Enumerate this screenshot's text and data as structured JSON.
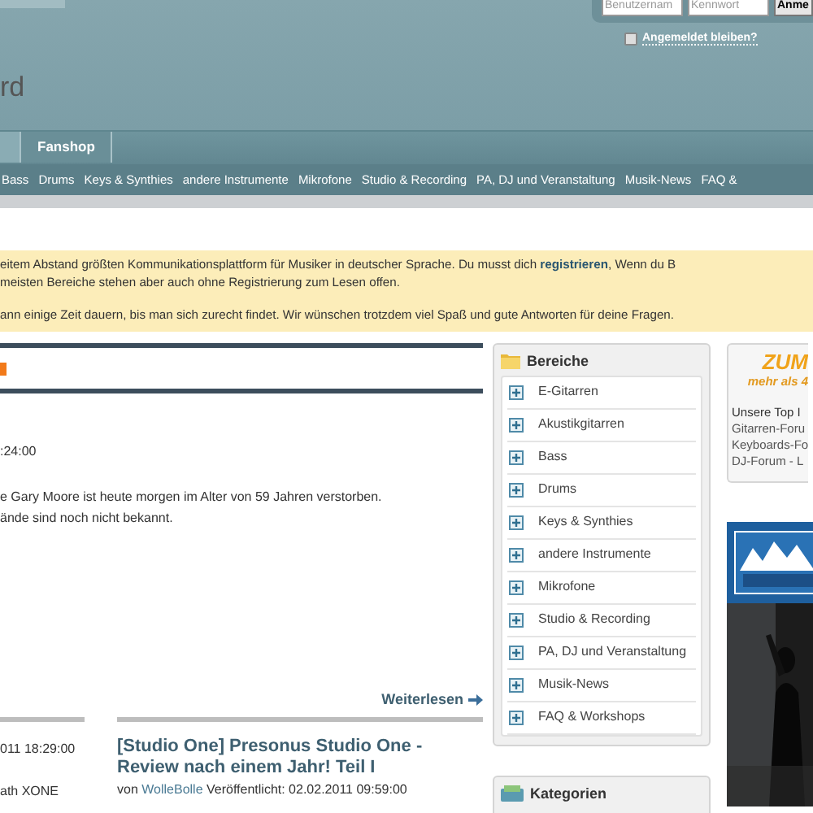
{
  "login": {
    "username": {
      "placeholder": "Benutzernam"
    },
    "password": {
      "placeholder": "Kennwort"
    },
    "button": "Anme",
    "remember": {
      "label": "Angemeldet bleiben?",
      "checked": false
    }
  },
  "site_title": "rd",
  "tabs": [
    {
      "selected": true
    },
    {
      "label": "Fanshop",
      "selected": false
    }
  ],
  "nav": [
    "Bass",
    "Drums",
    "Keys & Synthies",
    "andere Instrumente",
    "Mikrofone",
    "Studio & Recording",
    "PA, DJ und Veranstaltung",
    "Musik-News",
    "FAQ &"
  ],
  "notice": {
    "line_1": {
      "before": "eitem Abstand größten Kommunikationsplattform für Musiker in deutscher Sprache. Du musst dich ",
      "link": "registrieren",
      "after": ", Wenn du B"
    },
    "line_2": "meisten Bereiche stehen aber auch ohne Registrierung zum Lesen offen.",
    "line_3": "ann einige Zeit dauern, bis man sich zurecht findet. Wir wünschen trotzdem viel Spaß und gute Antworten für deine Fragen."
  },
  "main_article": {
    "date": ":24:00",
    "body": [
      "e Gary Moore ist heute morgen im Alter von 59 Jahren verstorben.",
      "ände sind noch nicht bekannt."
    ],
    "read_more": "Weiterlesen"
  },
  "article_left": {
    "date": "011 18:29:00",
    "line": "ath XONE"
  },
  "article_right": {
    "title": "[Studio One] Presonus Studio One - Review nach einem Jahr! Teil I",
    "by": "von ",
    "author": "WolleBolle",
    "published": " Veröffentlicht: 02.02.2011 09:59:00"
  },
  "sections": {
    "title": "Bereiche",
    "items": [
      "E-Gitarren",
      "Akustikgitarren",
      "Bass",
      "Drums",
      "Keys & Synthies",
      "andere Instrumente",
      "Mikrofone",
      "Studio & Recording",
      "PA, DJ und Veranstaltung",
      "Musik-News",
      "FAQ & Workshops"
    ]
  },
  "categories": {
    "title": "Kategorien"
  },
  "promo": {
    "headline": "ZUM",
    "subline": "mehr als 4",
    "intro": "Unsere Top I",
    "links": [
      "Gitarren-Foru",
      "Keyboards-Fo",
      "DJ-Forum - L"
    ]
  }
}
